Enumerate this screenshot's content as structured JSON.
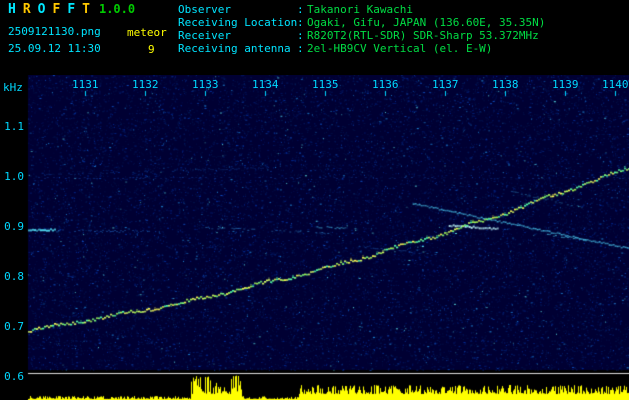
{
  "app": {
    "title_letters": [
      "H",
      "R",
      "O",
      "F",
      "F",
      "T"
    ],
    "version": "1.0.0",
    "filename": "2509121130.png",
    "mode_label": "meteor",
    "datetime": "25.09.12 11:30",
    "echo_count": "9"
  },
  "info": {
    "colon": ":",
    "rows": [
      {
        "label": "Observer",
        "value": "Takanori Kawachi"
      },
      {
        "label": "Receiving Location",
        "value": "Ogaki, Gifu, JAPAN (136.60E, 35.35N)"
      },
      {
        "label": "Receiver",
        "value": "R820T2(RTL-SDR) SDR-Sharp 53.372MHz"
      },
      {
        "label": "Receiving antenna",
        "value": "2el-HB9CV Vertical (el. E-W)"
      }
    ]
  },
  "spectrogram": {
    "y_axis": {
      "unit": "kHz",
      "ticks": [
        "1.1",
        "1.0",
        "0.9",
        "0.8",
        "0.7",
        "0.6"
      ]
    },
    "x_axis": {
      "ticks": [
        "1131",
        "1132",
        "1133",
        "1134",
        "1135",
        "1136",
        "1137",
        "1138",
        "1139",
        "1140"
      ]
    },
    "colors": {
      "background": "#000033",
      "axis_text": "#00d8ff",
      "tick": "#00d8ff",
      "amplitude": "#ffff00",
      "baseline": "#e0e0e0",
      "trace_palette": [
        "#7dff7d",
        "#aaff55",
        "#55ffaa",
        "#d8ff66",
        "#ffff55"
      ],
      "noise_palette": [
        "#001a55",
        "#002277",
        "#0033aa",
        "#1155cc",
        "#2299ee",
        "#66ffff"
      ]
    },
    "main_trace": {
      "points": [
        {
          "t": 0.0,
          "f": 0.694
        },
        {
          "t": 0.25,
          "f": 0.748
        },
        {
          "t": 0.5,
          "f": 0.82
        },
        {
          "t": 0.75,
          "f": 0.911
        },
        {
          "t": 1.0,
          "f": 1.02
        }
      ]
    },
    "streaks": [
      {
        "t0": 0.0,
        "f0": 0.896,
        "t1": 0.045,
        "f1": 0.896,
        "color": "#55eaff",
        "alpha": 0.95,
        "width": 2,
        "dash": false
      },
      {
        "t0": 0.05,
        "f0": 0.894,
        "t1": 0.21,
        "f1": 0.892,
        "color": "#2a7fe0",
        "alpha": 0.55,
        "width": 1,
        "dash": true
      },
      {
        "t0": 0.285,
        "f0": 0.9,
        "t1": 0.5,
        "f1": 0.889,
        "color": "#39a0e8",
        "alpha": 0.6,
        "width": 1,
        "dash": true
      },
      {
        "t0": 0.55,
        "f0": 0.862,
        "t1": 0.685,
        "f1": 0.845,
        "color": "#2a7fe0",
        "alpha": 0.5,
        "width": 1,
        "dash": true
      },
      {
        "t0": 0.64,
        "f0": 0.948,
        "t1": 1.0,
        "f1": 0.858,
        "color": "#49c8f0",
        "alpha": 0.85,
        "width": 1.5,
        "dash": false
      },
      {
        "t0": 0.7,
        "f0": 0.905,
        "t1": 0.78,
        "f1": 0.898,
        "color": "#bffcff",
        "alpha": 0.95,
        "width": 2,
        "dash": false
      },
      {
        "t0": 0.8,
        "f0": 0.972,
        "t1": 0.93,
        "f1": 0.938,
        "color": "#35a0d8",
        "alpha": 0.5,
        "width": 1,
        "dash": true
      },
      {
        "t0": 0.86,
        "f0": 0.886,
        "t1": 0.935,
        "f1": 0.874,
        "color": "#49c8f0",
        "alpha": 0.7,
        "width": 1.2,
        "dash": true
      },
      {
        "t0": 0.02,
        "f0": 1.005,
        "t1": 0.4,
        "f1": 1.02,
        "color": "#1b5fc0",
        "alpha": 0.35,
        "width": 1,
        "dash": true
      },
      {
        "t0": 0.47,
        "f0": 0.902,
        "t1": 0.545,
        "f1": 0.897,
        "color": "#49c8f0",
        "alpha": 0.65,
        "width": 1.2,
        "dash": true
      }
    ],
    "amplitude_segments": [
      {
        "t0": 0.0,
        "t1": 0.27,
        "min": 1,
        "max": 4
      },
      {
        "t0": 0.27,
        "t1": 0.355,
        "min": 6,
        "max": 26
      },
      {
        "t0": 0.355,
        "t1": 0.45,
        "min": 1,
        "max": 4
      },
      {
        "t0": 0.45,
        "t1": 1.01,
        "min": 6,
        "max": 15
      }
    ]
  }
}
